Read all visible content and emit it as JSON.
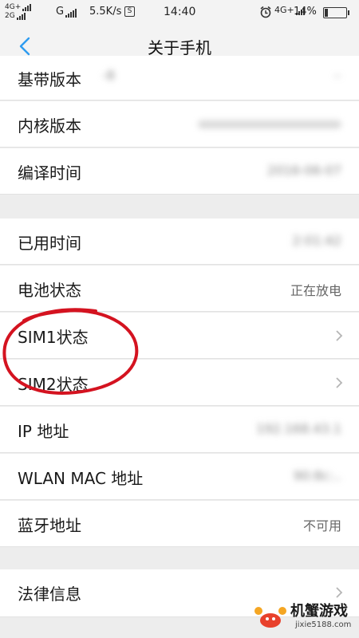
{
  "status_bar": {
    "net1": "4G+",
    "net2": "2G",
    "carrier_g": "G",
    "speed": "5.5K/s",
    "time": "14:40",
    "net3": "4G+",
    "battery": "14%",
    "battery_level": 0.14,
    "icons": [
      "signal-bars-icon",
      "data-saver-icon",
      "alarm-icon",
      "battery-icon"
    ]
  },
  "nav": {
    "title": "关于手机",
    "back_icon": "chevron-left-icon",
    "accent": "#2e9cf0"
  },
  "rows": [
    {
      "label": "基带版本",
      "value": "-8",
      "blurred": true
    },
    {
      "label": "内核版本",
      "value": "",
      "blurred": true
    },
    {
      "label": "编译时间",
      "value": "2016-06-07",
      "blurred": true
    },
    {
      "label": "已用时间",
      "value": "2:01:42",
      "blurred": true
    },
    {
      "label": "电池状态",
      "value": "正在放电",
      "blurred": false
    },
    {
      "label": "SIM1状态",
      "value": "",
      "has_chevron": true
    },
    {
      "label": "SIM2状态",
      "value": "",
      "has_chevron": true
    },
    {
      "label": "IP 地址",
      "value": "192.168.43.1",
      "blurred": true
    },
    {
      "label": "WLAN MAC 地址",
      "value": "90:8c:..",
      "blurred": true
    },
    {
      "label": "蓝牙地址",
      "value": "不可用",
      "blurred": false
    },
    {
      "label": "法律信息",
      "value": "",
      "has_chevron": true
    }
  ],
  "annotation_color": "#d41320",
  "watermark": {
    "name": "机蟹游戏",
    "url": "jixie5188.com"
  }
}
